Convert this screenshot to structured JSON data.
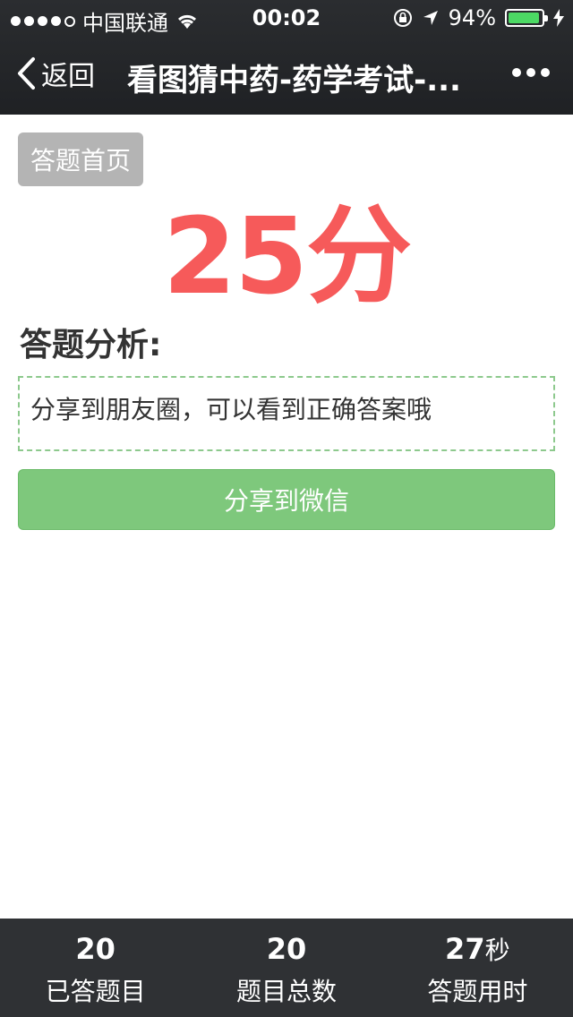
{
  "status_bar": {
    "carrier": "中国联通",
    "time": "00:02",
    "battery": "94%",
    "battery_level": 0.94,
    "signal_bars": 4
  },
  "nav": {
    "back_label": "返回",
    "title": "看图猜中药-药学考试-..."
  },
  "main": {
    "home_button": "答题首页",
    "score": "25分",
    "analysis_title": "答题分析:",
    "analysis_text": "分享到朋友圈，可以看到正确答案哦",
    "share_button": "分享到微信"
  },
  "stats": [
    {
      "value": "20",
      "unit": "",
      "label": "已答题目"
    },
    {
      "value": "20",
      "unit": "",
      "label": "题目总数"
    },
    {
      "value": "27",
      "unit": "秒",
      "label": "答题用时"
    }
  ],
  "colors": {
    "score": "#f65a5a",
    "share_button": "#7ec87c",
    "home_button": "#b4b4b4",
    "battery": "#4cd964"
  }
}
